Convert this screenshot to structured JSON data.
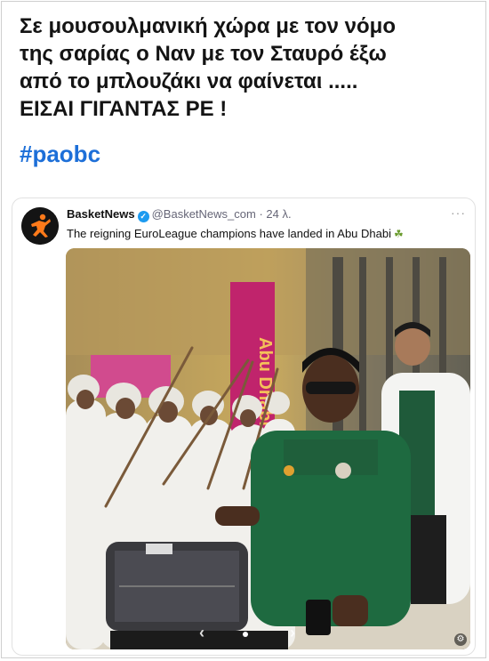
{
  "post": {
    "lines": [
      "Σε μουσουλμανική χώρα με τον νόμο",
      "της σαρίας ο Ναν με τον Σταυρό έξω",
      "από το μπλουζάκι να φαίνεται .....",
      "ΕΙΣΑΙ ΓΙΓΑΝΤΑΣ ΡΕ !"
    ],
    "hashtag": "#paobc",
    "hashtag_color": "#1d6fd8"
  },
  "tweet": {
    "account_name": "BasketNews",
    "handle": "@BasketNews_com",
    "time": "· 24 λ.",
    "more": "···",
    "text": "The reigning EuroLeague champions have landed in Abu Dhabi",
    "emoji": "☘",
    "verified_icon": "verified-badge-icon",
    "verified_glyph": "✓",
    "media": {
      "sign_text": "Abu Dhabi",
      "prev": "‹",
      "next": "›",
      "settings_glyph": "⚙"
    }
  }
}
